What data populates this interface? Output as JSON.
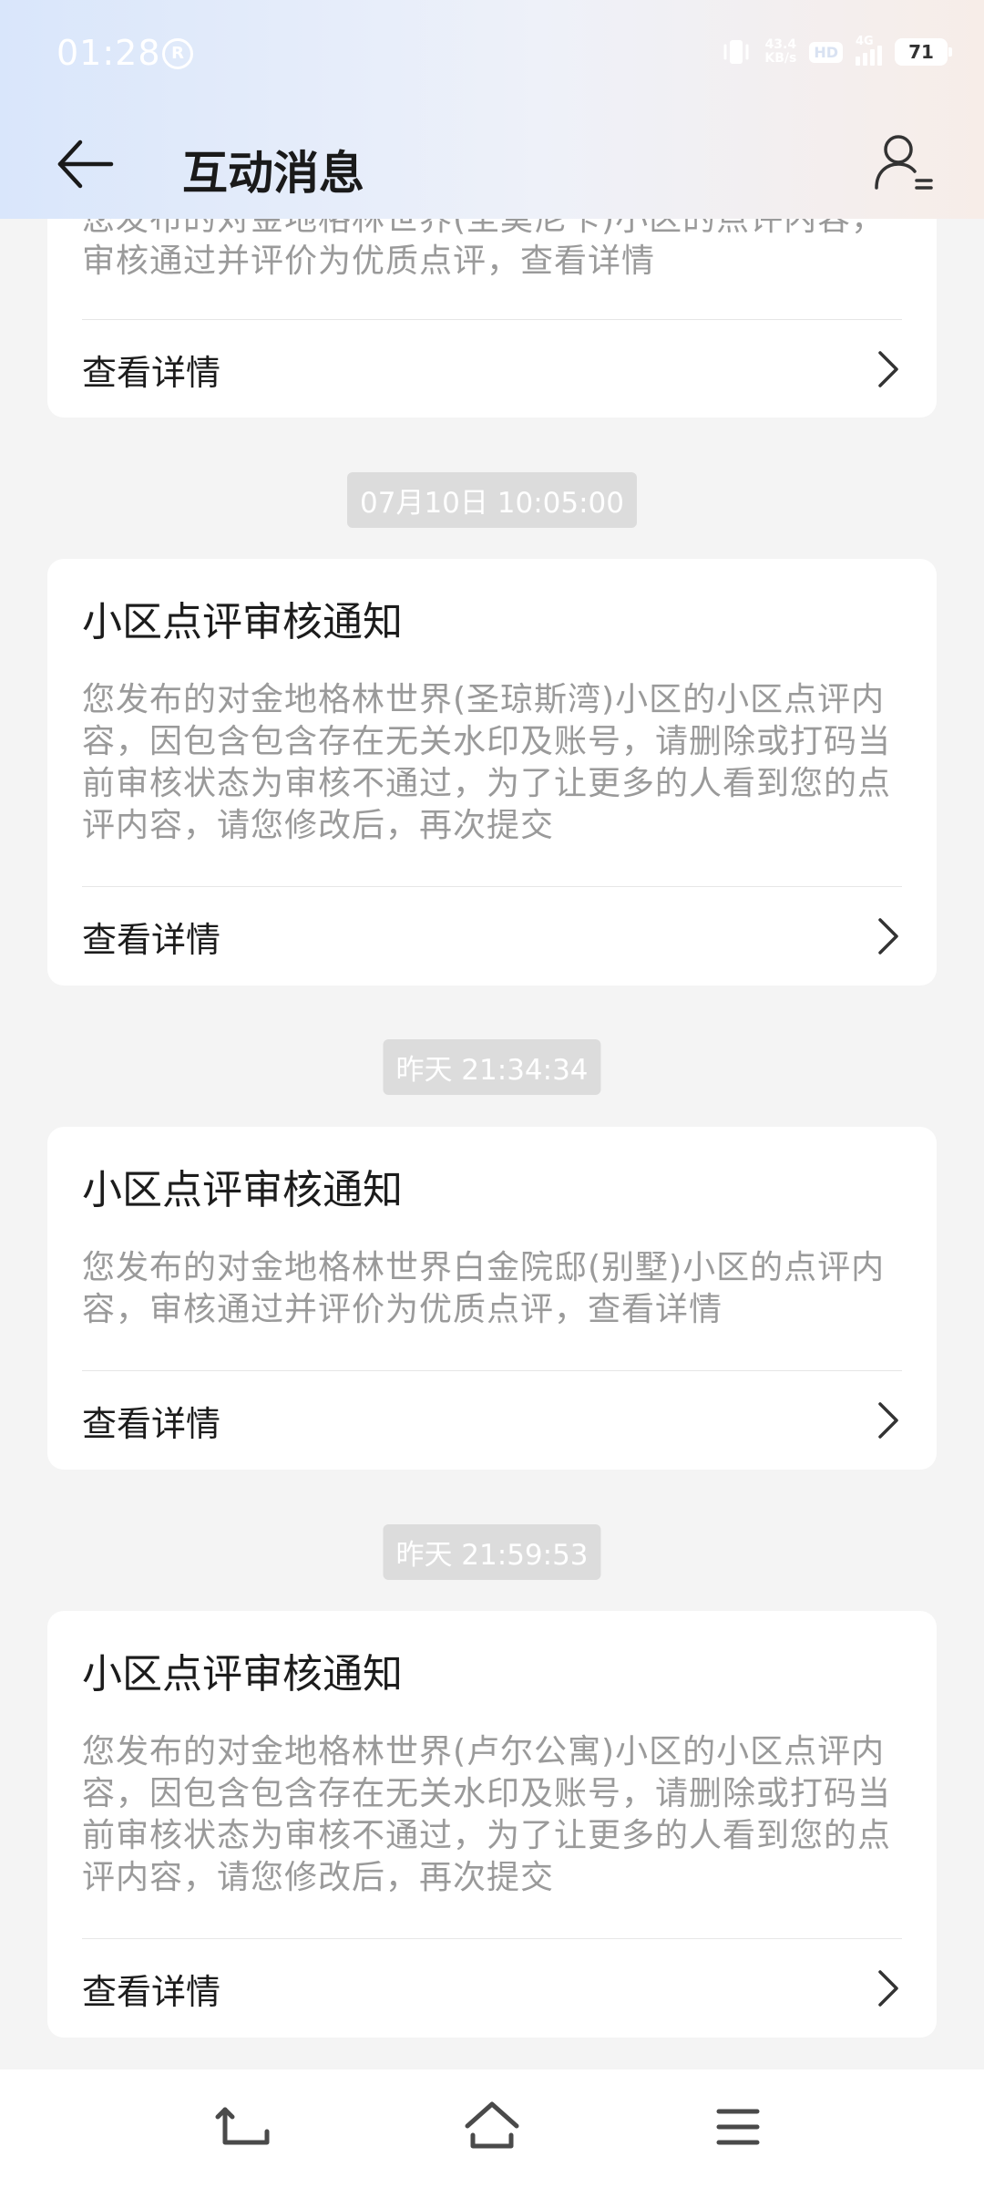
{
  "status_bar": {
    "time": "01:28",
    "net_speed_value": "43.4",
    "net_speed_unit": "KB/s",
    "hd_label": "HD",
    "network_label": "4G",
    "battery": "71"
  },
  "header": {
    "title": "互动消息"
  },
  "cards": [
    {
      "body": "您发布的对金地格林世界(圣莫尼卡)小区的点评内容，审核通过并评价为优质点评，查看详情",
      "link": "查看详情"
    },
    {
      "timestamp": "07月10日  10:05:00",
      "title": "小区点评审核通知",
      "body": "您发布的对金地格林世界(圣琼斯湾)小区的小区点评内容，因包含包含存在无关水印及账号，请删除或打码当前审核状态为审核不通过，为了让更多的人看到您的点评内容，请您修改后，再次提交",
      "link": "查看详情"
    },
    {
      "timestamp": "昨天  21:34:34",
      "title": "小区点评审核通知",
      "body": "您发布的对金地格林世界白金院邸(别墅)小区的点评内容，审核通过并评价为优质点评，查看详情",
      "link": "查看详情"
    },
    {
      "timestamp": "昨天  21:59:53",
      "title": "小区点评审核通知",
      "body": "您发布的对金地格林世界(卢尔公寓)小区的小区点评内容，因包含包含存在无关水印及账号，请删除或打码当前审核状态为审核不通过，为了让更多的人看到您的点评内容，请您修改后，再次提交",
      "link": "查看详情"
    }
  ],
  "icons": {
    "back": "arrow-left-icon",
    "user": "user-settings-icon",
    "chevron": "chevron-right-icon",
    "nav_back": "nav-back-icon",
    "nav_home": "nav-home-icon",
    "nav_menu": "nav-menu-icon"
  }
}
